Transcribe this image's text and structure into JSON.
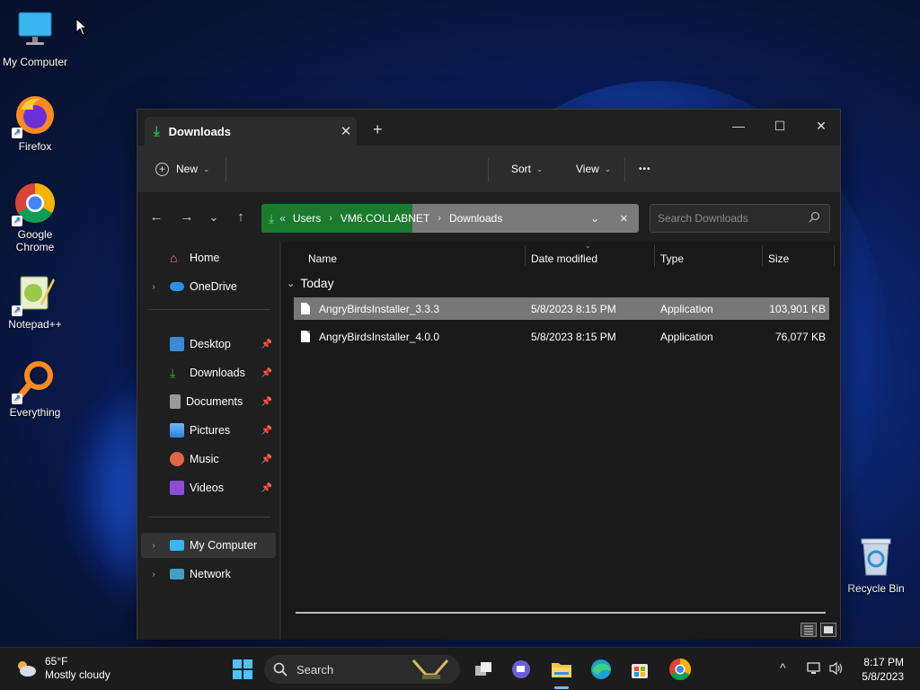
{
  "desktop": {
    "icons": [
      {
        "label": "My Computer",
        "icon": "monitor-icon"
      },
      {
        "label": "Firefox",
        "icon": "firefox-icon"
      },
      {
        "label": "Google Chrome",
        "icon": "chrome-icon"
      },
      {
        "label": "Notepad++",
        "icon": "notepadpp-icon"
      },
      {
        "label": "Everything",
        "icon": "everything-icon"
      },
      {
        "label": "Recycle Bin",
        "icon": "recycle-bin-icon"
      }
    ]
  },
  "explorer": {
    "tab_title": "Downloads",
    "tab_close": "✕",
    "new_tab": "+",
    "window_controls": {
      "minimize": "—",
      "maximize": "☐",
      "close": "✕"
    },
    "toolbar": {
      "new_label": "New",
      "sort_label": "Sort",
      "view_label": "View",
      "more_label": "•••"
    },
    "nav": {
      "back": "←",
      "forward": "→",
      "recent": "⌄",
      "up": "↑"
    },
    "address": {
      "overflow": "«",
      "crumbs": [
        "Users",
        "VM6.COLLABNET",
        "Downloads"
      ],
      "separator": "›",
      "dropdown": "⌄",
      "clear": "✕"
    },
    "search": {
      "placeholder": "Search Downloads"
    },
    "sidebar": {
      "home": "Home",
      "onedrive": "OneDrive",
      "quick_access": [
        {
          "label": "Desktop",
          "icon": "desktop-folder-icon",
          "color": "#3a8ad6"
        },
        {
          "label": "Downloads",
          "icon": "download-folder-icon",
          "color": "#2fa84f"
        },
        {
          "label": "Documents",
          "icon": "documents-folder-icon",
          "color": "#8c8c8c"
        },
        {
          "label": "Pictures",
          "icon": "pictures-folder-icon",
          "color": "#3c8fe0"
        },
        {
          "label": "Music",
          "icon": "music-folder-icon",
          "color": "#e0664a"
        },
        {
          "label": "Videos",
          "icon": "videos-folder-icon",
          "color": "#8a4fd6"
        }
      ],
      "my_computer": "My Computer",
      "network": "Network"
    },
    "columns": {
      "name": "Name",
      "date": "Date modified",
      "type": "Type",
      "size": "Size"
    },
    "group_label": "Today",
    "files": [
      {
        "name": "AngryBirdsInstaller_3.3.3",
        "date": "5/8/2023 8:15 PM",
        "type": "Application",
        "size": "103,901 KB",
        "selected": true
      },
      {
        "name": "AngryBirdsInstaller_4.0.0",
        "date": "5/8/2023 8:15 PM",
        "type": "Application",
        "size": "76,077 KB",
        "selected": false
      }
    ]
  },
  "taskbar": {
    "weather_temp": "65°F",
    "weather_desc": "Mostly cloudy",
    "search_label": "Search",
    "time": "8:17 PM",
    "date": "5/8/2023",
    "tray_chevron": "^"
  }
}
